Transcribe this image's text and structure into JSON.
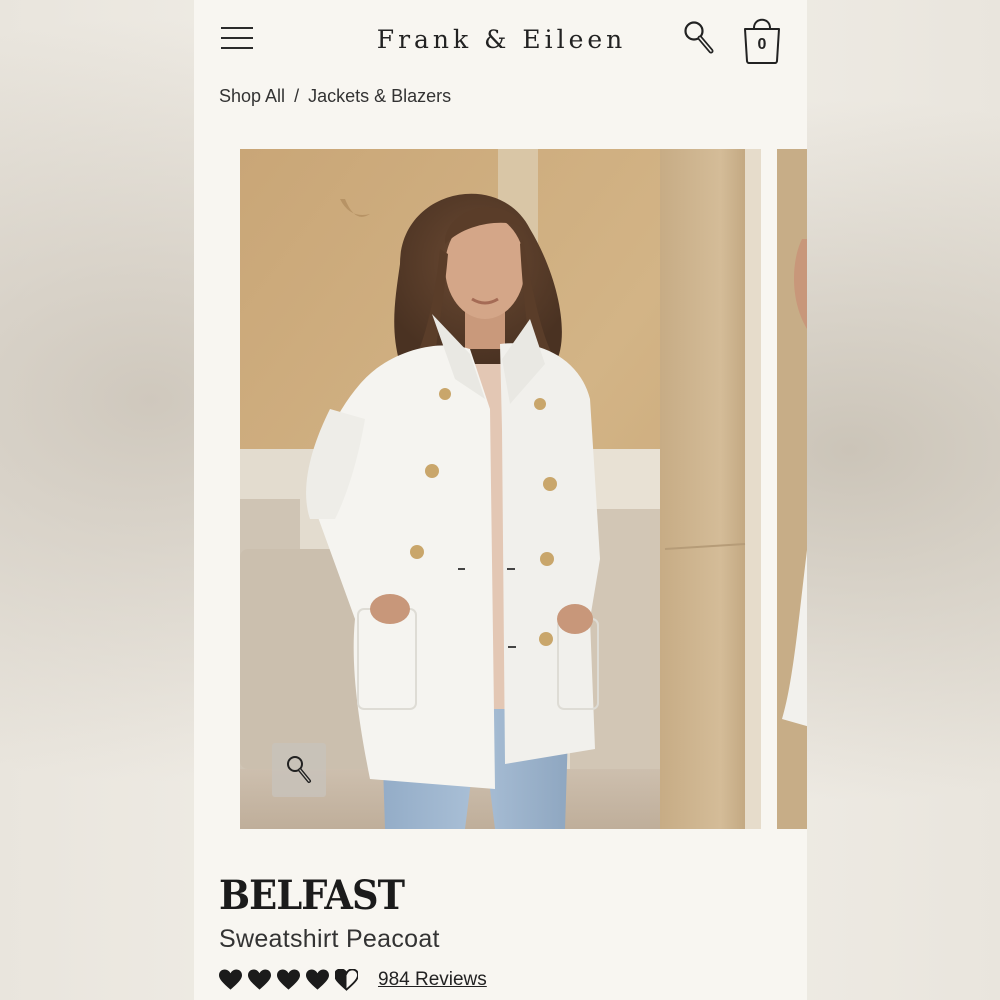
{
  "header": {
    "brand": "Frank & Eileen",
    "cart_count": "0"
  },
  "breadcrumb": {
    "items": [
      "Shop All",
      "Jackets & Blazers"
    ],
    "separator": "/"
  },
  "gallery": {
    "zoom_icon": "magnifier-icon"
  },
  "product": {
    "name": "BELFAST",
    "subtitle": "Sweatshirt Peacoat",
    "rating": 4.5,
    "rating_max": 5,
    "reviews_label": "984 Reviews"
  },
  "colors": {
    "page_bg": "#f8f6f1",
    "text": "#1b1b1b",
    "coat": "#f5f4f0",
    "button_gold": "#c9a66b"
  }
}
